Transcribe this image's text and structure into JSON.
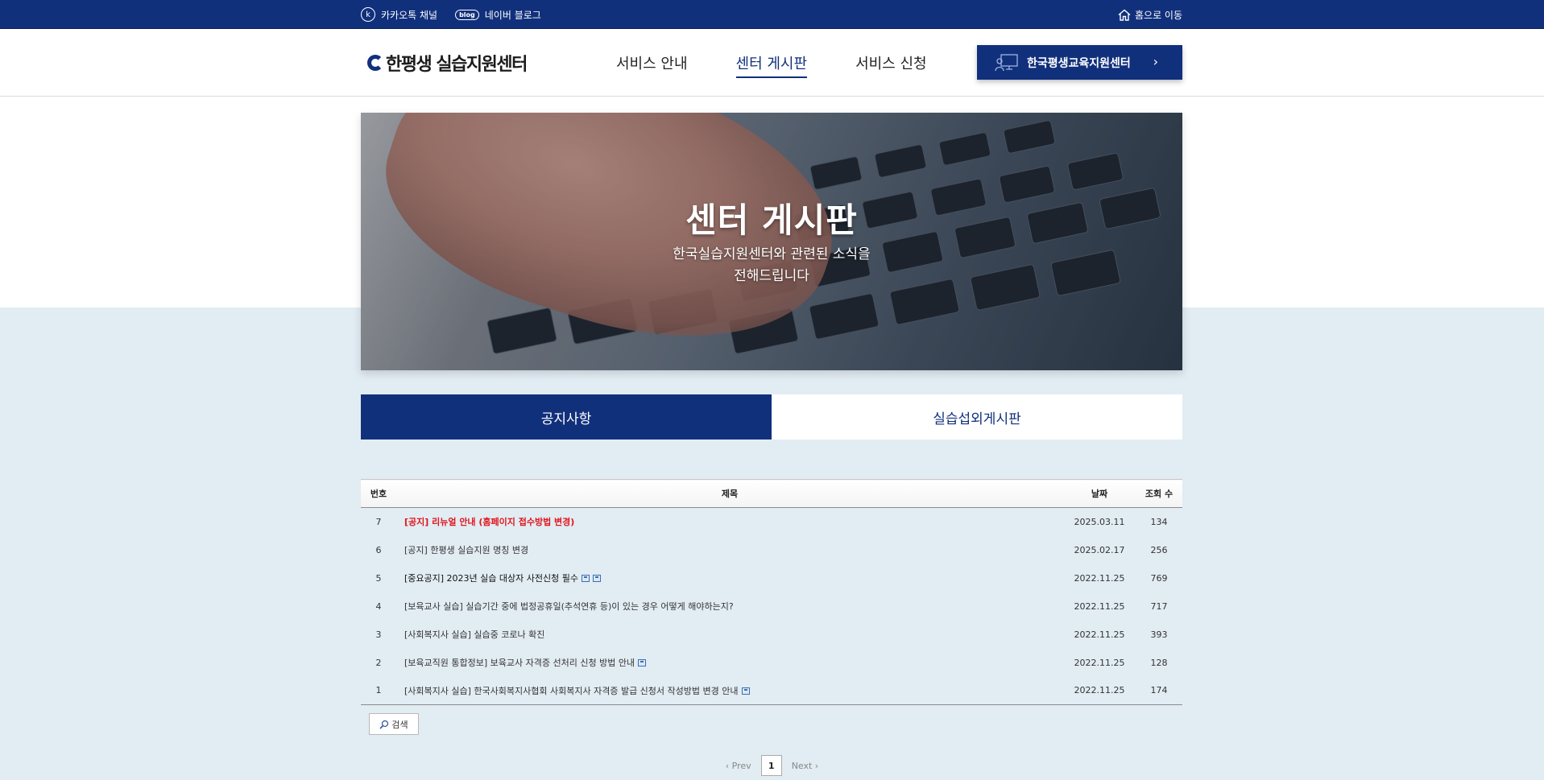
{
  "topbar": {
    "kakao_label": "카카오톡 채널",
    "kakao_icon_letter": "k",
    "blog_badge": "blog",
    "blog_label": "네이버 블로그",
    "home_label": "홈으로 이동"
  },
  "header": {
    "logo_text": "한평생 실습지원센터",
    "nav": [
      {
        "label": "서비스 안내",
        "active": false
      },
      {
        "label": "센터 게시판",
        "active": true
      },
      {
        "label": "서비스 신청",
        "active": false
      }
    ],
    "cta_label": "한국평생교육지원센터",
    "cta_chevron": "›"
  },
  "hero": {
    "title": "센터 게시판",
    "subtitle_line1": "한국실습지원센터와 관련된 소식을",
    "subtitle_line2": "전해드립니다"
  },
  "tabs": [
    {
      "label": "공지사항",
      "active": true
    },
    {
      "label": "실습섭외게시판",
      "active": false
    }
  ],
  "board": {
    "columns": {
      "num": "번호",
      "title": "제목",
      "date": "날짜",
      "views": "조회 수"
    },
    "rows": [
      {
        "num": "7",
        "title": "[공지] 리뉴얼 안내 (홈페이지 접수방법 변경)",
        "date": "2025.03.11",
        "views": "134",
        "style": "notice",
        "files": 0
      },
      {
        "num": "6",
        "title": "[공지] 한평생 실습지원 명칭 변경",
        "date": "2025.02.17",
        "views": "256",
        "style": "normal",
        "files": 0
      },
      {
        "num": "5",
        "title": "[중요공지] 2023년 실습 대상자 사전신청 필수",
        "date": "2022.11.25",
        "views": "769",
        "style": "strong",
        "files": 2
      },
      {
        "num": "4",
        "title": "[보육교사 실습] 실습기간 중에 법정공휴일(추석연휴 등)이 있는 경우 어떻게 해야하는지?",
        "date": "2022.11.25",
        "views": "717",
        "style": "normal",
        "files": 0
      },
      {
        "num": "3",
        "title": "[사회복지사 실습] 실습중 코로나 확진",
        "date": "2022.11.25",
        "views": "393",
        "style": "normal",
        "files": 0
      },
      {
        "num": "2",
        "title": "[보육교직원 통합정보] 보육교사 자격증 선처리 신청 방법 안내",
        "date": "2022.11.25",
        "views": "128",
        "style": "normal",
        "files": 1
      },
      {
        "num": "1",
        "title": "[사회복지사 실습] 한국사회복지사협회 사회복지사 자격증 발급 신청서 작성방법 변경 안내",
        "date": "2022.11.25",
        "views": "174",
        "style": "normal",
        "files": 1
      }
    ]
  },
  "search_label": "검색",
  "paging": {
    "prev": "‹ Prev",
    "current": "1",
    "next": "Next ›"
  },
  "colors": {
    "brand": "#11307c",
    "notice": "#e0151b",
    "band": "#e2ecf3"
  }
}
